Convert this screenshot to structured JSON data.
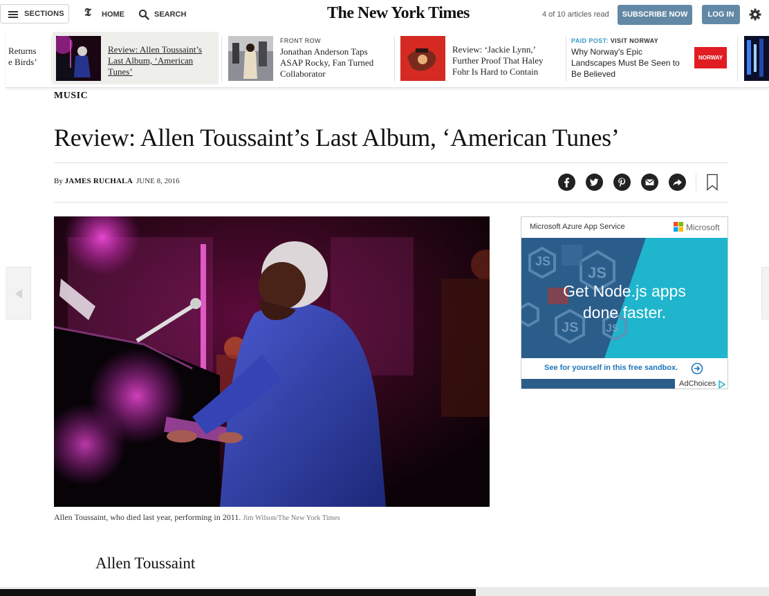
{
  "header": {
    "sections_label": "SECTIONS",
    "home_label": "HOME",
    "search_label": "SEARCH",
    "logo_text": "The New York Times",
    "articles_count": "4 of 10 articles read",
    "subscribe_label": "SUBSCRIBE NOW",
    "login_label": "LOG IN"
  },
  "ribbon": {
    "items": [
      {
        "headline_l1": "Returns",
        "headline_l2": "e Birds’"
      },
      {
        "headline_l1": "Review: Allen Toussaint’s",
        "headline_l2": "Last Album, ‘American",
        "headline_l3": "Tunes’"
      },
      {
        "kicker": "FRONT ROW",
        "headline_l1": "Jonathan Anderson Taps",
        "headline_l2": "ASAP Rocky, Fan Turned",
        "headline_l3": "Collaborator"
      },
      {
        "headline_l1": "Review: ‘Jackie Lynn,’",
        "headline_l2": "Further Proof That Haley",
        "headline_l3": "Fohr Is Hard to Contain"
      },
      {
        "kicker_paid": "PAID POST:",
        "kicker_sponsor": "VISIT NORWAY",
        "headline_l1": "Why Norway's Epic",
        "headline_l2": "Landscapes Must Be Seen to",
        "headline_l3": "Be Believed",
        "badge": "NORWAY"
      }
    ]
  },
  "article": {
    "section": "MUSIC",
    "headline": "Review: Allen Toussaint’s Last Album, ‘American Tunes’",
    "byline_prefix": "By",
    "author": "JAMES RUCHALA",
    "date": "JUNE 8, 2016",
    "caption": "Allen Toussaint, who died last year, performing in 2011.",
    "credit": "Jim Wilson/The New York Times",
    "subhead": "Allen Toussaint"
  },
  "share_icons": [
    "facebook-icon",
    "twitter-icon",
    "pinterest-icon",
    "email-icon",
    "share-icon",
    "bookmark-icon"
  ],
  "ad": {
    "title": "Microsoft Azure App Service",
    "brand": "Microsoft",
    "tagline_l1": "Get Node.js apps",
    "tagline_l2": "done faster.",
    "cta": "See for yourself in this free sandbox.",
    "adchoices": "AdChoices",
    "colors": {
      "cyan": "#1fb5cc",
      "navy": "#2b5d8a",
      "cta_blue": "#1d76b8"
    }
  },
  "colors": {
    "button_blue": "#6288a5",
    "ribbon_active_bg": "#eeeeea"
  }
}
